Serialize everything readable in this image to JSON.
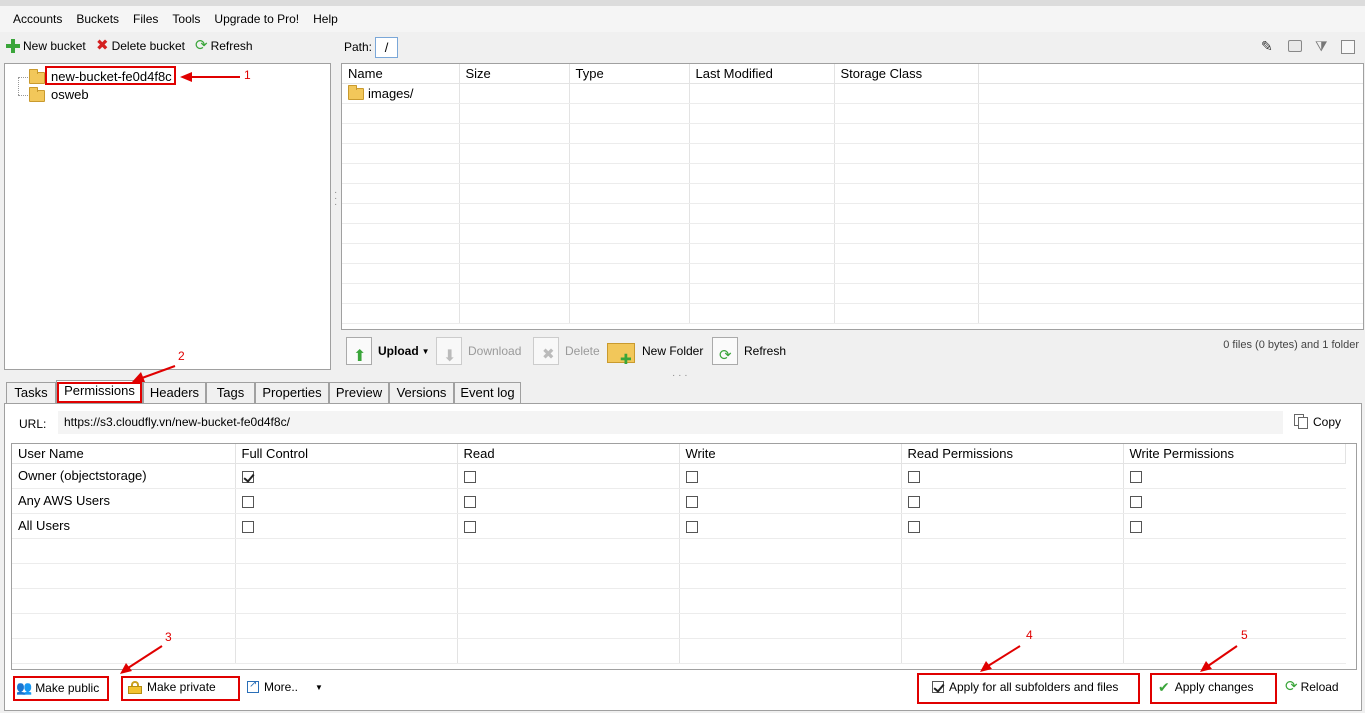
{
  "menu": [
    "Accounts",
    "Buckets",
    "Files",
    "Tools",
    "Upgrade to Pro!",
    "Help"
  ],
  "left_toolbar": {
    "new_bucket": "New bucket",
    "delete_bucket": "Delete bucket",
    "refresh": "Refresh"
  },
  "buckets": [
    "new-bucket-fe0d4f8c",
    "osweb"
  ],
  "path": {
    "label": "Path:",
    "value": "/"
  },
  "files_table": {
    "columns": [
      "Name",
      "Size",
      "Type",
      "Last Modified",
      "Storage Class"
    ],
    "rows": [
      {
        "name": "images/",
        "size": "",
        "type": "",
        "modified": "",
        "storage": ""
      }
    ]
  },
  "file_toolbar": {
    "upload": "Upload",
    "download": "Download",
    "delete": "Delete",
    "new_folder": "New Folder",
    "refresh": "Refresh"
  },
  "status": "0 files (0 bytes) and 1 folder",
  "tabs": [
    "Tasks",
    "Permissions",
    "Headers",
    "Tags",
    "Properties",
    "Preview",
    "Versions",
    "Event log"
  ],
  "url": {
    "label": "URL:",
    "value": "https://s3.cloudfly.vn/new-bucket-fe0d4f8c/",
    "copy": "Copy"
  },
  "permissions": {
    "columns": [
      "User Name",
      "Full Control",
      "Read",
      "Write",
      "Read Permissions",
      "Write Permissions"
    ],
    "rows": [
      {
        "user": "Owner (objectstorage)",
        "checks": [
          true,
          false,
          false,
          false,
          false
        ]
      },
      {
        "user": "Any AWS Users",
        "checks": [
          false,
          false,
          false,
          false,
          false
        ]
      },
      {
        "user": "All Users",
        "checks": [
          false,
          false,
          false,
          false,
          false
        ]
      }
    ]
  },
  "bottom": {
    "make_public": "Make public",
    "make_private": "Make private",
    "more": "More..",
    "apply_all": "Apply for all subfolders and files",
    "apply_changes": "Apply changes",
    "reload": "Reload"
  },
  "annotations": [
    "1",
    "2",
    "3",
    "4",
    "5"
  ],
  "colors": {
    "accent": "#e00000",
    "folder": "#f2c75a",
    "green": "#3aa53a"
  }
}
